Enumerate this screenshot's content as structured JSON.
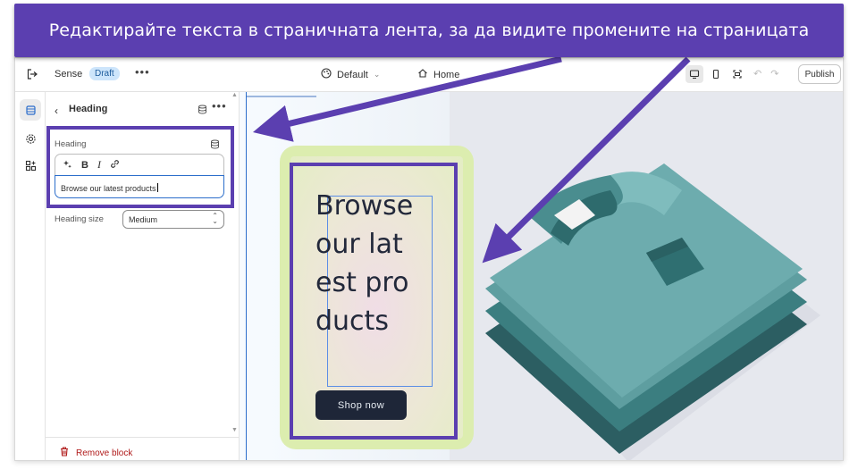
{
  "banner": {
    "text": "Редактирайте текста в страничната лента, за да видите промените на страницата"
  },
  "topbar": {
    "theme_name": "Sense",
    "status_badge": "Draft",
    "more": "•••",
    "template_select": "Default",
    "page_select": "Home",
    "publish_label": "Publish"
  },
  "panel": {
    "back_title": "Heading",
    "more": "•••",
    "heading_field_label": "Heading",
    "heading_value": "Browse our latest products",
    "size_label": "Heading size",
    "size_value": "Medium",
    "remove_label": "Remove block"
  },
  "preview": {
    "heading": "Browse our latest products",
    "button_label": "Shop now"
  },
  "colors": {
    "annotation": "#5b3fb0",
    "accent_blue": "#2c6ecb",
    "card_bg": "#dcedaf",
    "button_bg": "#1e2638",
    "shirt_teal": "#5e9ea0"
  },
  "icons": [
    "exit-icon",
    "palette-icon",
    "home-icon",
    "desktop-icon",
    "mobile-icon",
    "fullscreen-icon",
    "undo-icon",
    "redo-icon",
    "sections-icon",
    "gear-icon",
    "apps-icon",
    "database-icon",
    "sparkle-icon",
    "link-icon",
    "trash-icon"
  ]
}
